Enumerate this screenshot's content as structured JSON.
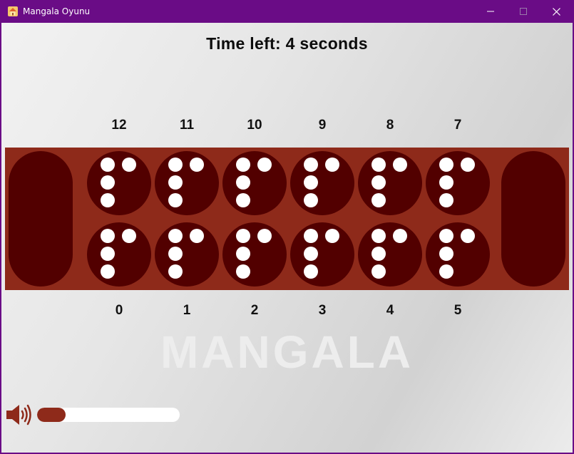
{
  "window": {
    "title": "Mangala Oyunu"
  },
  "timer": {
    "text": "Time left: 4 seconds"
  },
  "top_labels": [
    "12",
    "11",
    "10",
    "9",
    "8",
    "7"
  ],
  "bottom_labels": [
    "0",
    "1",
    "2",
    "3",
    "4",
    "5"
  ],
  "board": {
    "top_pits_stones": [
      4,
      4,
      4,
      4,
      4,
      4
    ],
    "bottom_pits_stones": [
      4,
      4,
      4,
      4,
      4,
      4
    ],
    "left_store_stones": 0,
    "right_store_stones": 0
  },
  "watermark": {
    "text": "MANGALA"
  },
  "volume": {
    "level": 0.2
  },
  "colors": {
    "titlebar": "#6a0c86",
    "board": "#8e2a1a",
    "pit": "#520000",
    "stone": "#ffffff",
    "watermark": "#ededed"
  },
  "icons": {
    "app": "house-icon",
    "speaker": "speaker-icon"
  }
}
